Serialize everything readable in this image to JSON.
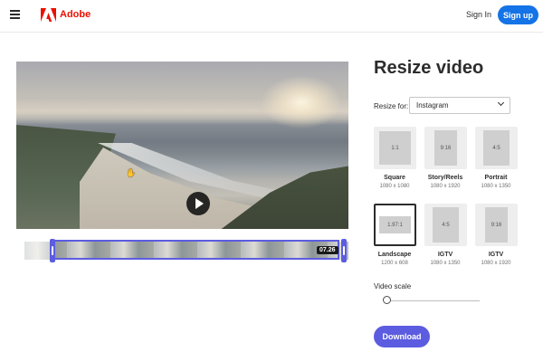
{
  "header": {
    "brand": "Adobe",
    "signin": "Sign In",
    "signup": "Sign up"
  },
  "colors": {
    "brand_red": "#eb1000",
    "signup_blue": "#1473e6",
    "accent": "#5c5ce0"
  },
  "icons": [
    "hamburger-menu-icon",
    "adobe-logo-icon",
    "play-icon",
    "chevron-down-icon",
    "hand-cursor-icon"
  ],
  "timeline": {
    "duration": "07.26"
  },
  "panel": {
    "title": "Resize video",
    "resize_label": "Resize for:",
    "resize_value": "Instagram",
    "scale_label": "Video scale",
    "scale_value": 0.05,
    "download": "Download"
  },
  "tiles": [
    {
      "ratio": "1:1",
      "name": "Square",
      "size": "1080 x 1080",
      "selected": false
    },
    {
      "ratio": "9:16",
      "name": "Story/Reels",
      "size": "1080 x 1920",
      "selected": false
    },
    {
      "ratio": "4:5",
      "name": "Portrait",
      "size": "1080 x 1350",
      "selected": false
    },
    {
      "ratio": "1.97:1",
      "name": "Landscape",
      "size": "1200 x 608",
      "selected": true
    },
    {
      "ratio": "4:5",
      "name": "IGTV",
      "size": "1080 x 1350",
      "selected": false
    },
    {
      "ratio": "9:16",
      "name": "IGTV",
      "size": "1080 x 1920",
      "selected": false
    }
  ]
}
